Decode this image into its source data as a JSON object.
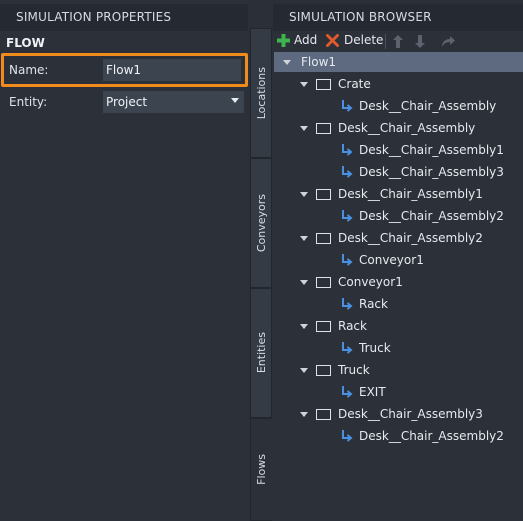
{
  "left_panel": {
    "header": "SIMULATION PROPERTIES",
    "section": "FLOW",
    "name_label": "Name:",
    "name_value": "Flow1",
    "entity_label": "Entity:",
    "entity_value": "Project"
  },
  "tabs": [
    "Locations",
    "Conveyors",
    "Entities",
    "Flows"
  ],
  "right_panel": {
    "header": "SIMULATION BROWSER",
    "toolbar": {
      "add": "Add",
      "delete": "Delete"
    },
    "tree": [
      {
        "label": "Flow1",
        "kind": "root"
      },
      {
        "label": "Crate",
        "kind": "node"
      },
      {
        "label": "Desk__Chair_Assembly",
        "kind": "leaf"
      },
      {
        "label": "Desk__Chair_Assembly",
        "kind": "node"
      },
      {
        "label": "Desk__Chair_Assembly1",
        "kind": "leaf"
      },
      {
        "label": "Desk__Chair_Assembly3",
        "kind": "leaf"
      },
      {
        "label": "Desk__Chair_Assembly1",
        "kind": "node"
      },
      {
        "label": "Desk__Chair_Assembly2",
        "kind": "leaf"
      },
      {
        "label": "Desk__Chair_Assembly2",
        "kind": "node"
      },
      {
        "label": "Conveyor1",
        "kind": "leaf"
      },
      {
        "label": "Conveyor1",
        "kind": "node"
      },
      {
        "label": "Rack",
        "kind": "leaf"
      },
      {
        "label": "Rack",
        "kind": "node"
      },
      {
        "label": "Truck",
        "kind": "leaf"
      },
      {
        "label": "Truck",
        "kind": "node"
      },
      {
        "label": "EXIT",
        "kind": "leaf"
      },
      {
        "label": "Desk__Chair_Assembly3",
        "kind": "node"
      },
      {
        "label": "Desk__Chair_Assembly2",
        "kind": "leaf"
      }
    ]
  },
  "colors": {
    "highlight": "#f08b1c",
    "add_icon": "#3fb34f",
    "delete_icon": "#e05a2b",
    "link_icon": "#4a8fe0",
    "selection": "#5d6a80"
  }
}
